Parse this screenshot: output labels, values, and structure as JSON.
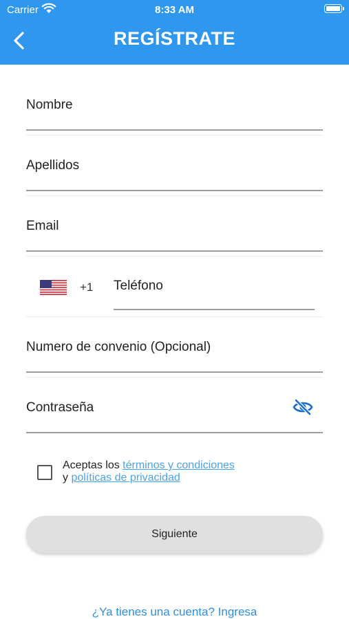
{
  "status_bar": {
    "carrier": "Carrier",
    "time": "8:33 AM"
  },
  "header": {
    "title": "REGÍSTRATE"
  },
  "form": {
    "fields": [
      {
        "label": "Nombre"
      },
      {
        "label": "Apellidos"
      },
      {
        "label": "Email"
      },
      {
        "label": "Numero de convenio (Opcional)"
      },
      {
        "label": "Contraseña"
      }
    ],
    "phone": {
      "dial_code": "+1",
      "label": "Teléfono",
      "country_flag": "us-flag-icon"
    }
  },
  "terms": {
    "prefix": "Aceptas los ",
    "terms_link": "términos y condiciones ",
    "joiner": "y ",
    "privacy_link": "políticas de privacidad",
    "checked": false
  },
  "actions": {
    "next_label": "Siguiente",
    "login_prompt": "¿Ya tienes una cuenta? Ingresa"
  },
  "colors": {
    "header": "#2f97ee",
    "link": "#4aa3ea",
    "eye_icon": "#1a6fd1",
    "button_bg": "#e0e0e0"
  }
}
